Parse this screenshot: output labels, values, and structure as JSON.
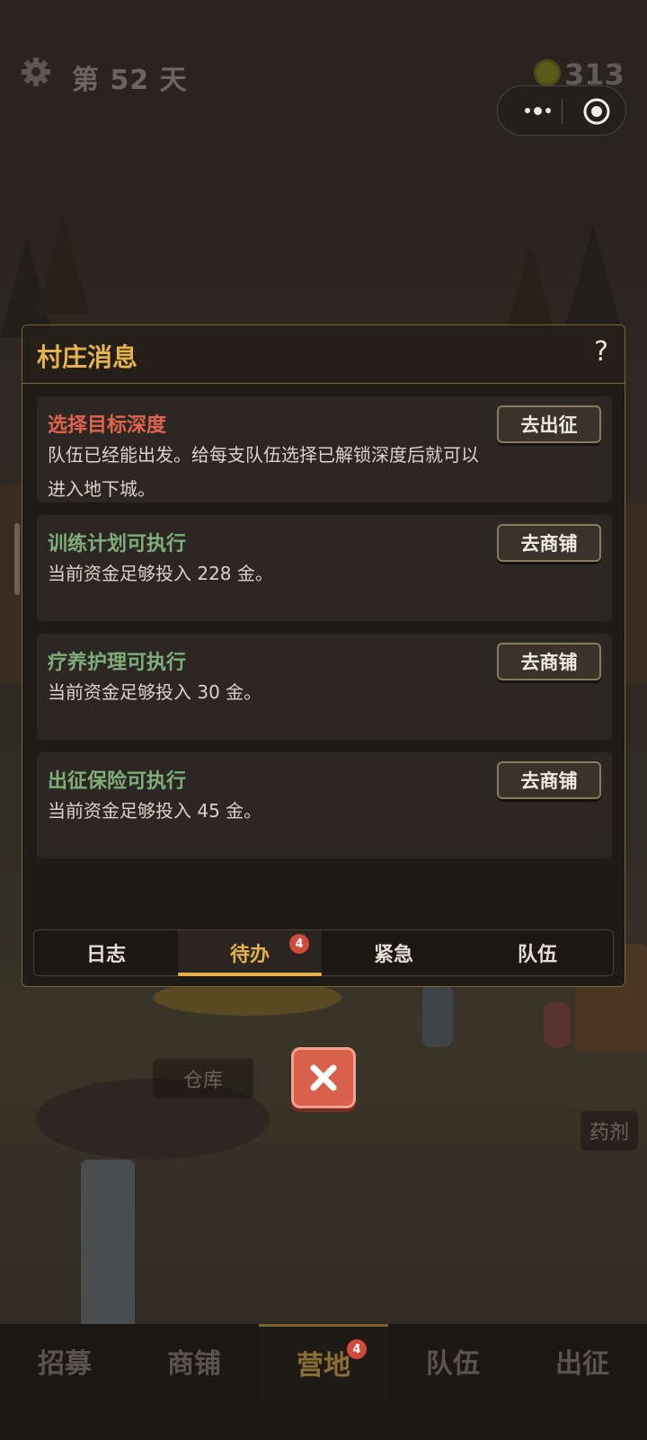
{
  "hud": {
    "day_label": "第 52 天",
    "gold": "313",
    "coin_color": "#5c5a1a"
  },
  "scene": {
    "warehouse_label": "仓库",
    "pharmacy_label": "药剂"
  },
  "dialog": {
    "title": "村庄消息",
    "help": "?",
    "cards": [
      {
        "title": "选择目标深度",
        "body": "队伍已经能出发。给每支队伍选择已解锁深度后就可以进入地下城。",
        "button": "去出征",
        "title_color": "#e2634d"
      },
      {
        "title": "训练计划可执行",
        "body": "当前资金足够投入 228 金。",
        "button": "去商铺",
        "title_color": "#7fae7a"
      },
      {
        "title": "疗养护理可执行",
        "body": "当前资金足够投入 30 金。",
        "button": "去商铺",
        "title_color": "#7fae7a"
      },
      {
        "title": "出征保险可执行",
        "body": "当前资金足够投入 45 金。",
        "button": "去商铺",
        "title_color": "#7fae7a"
      }
    ],
    "tabs": [
      {
        "label": "日志"
      },
      {
        "label": "待办",
        "badge": "4",
        "active": true
      },
      {
        "label": "紧急"
      },
      {
        "label": "队伍"
      }
    ]
  },
  "nav": {
    "items": [
      {
        "label": "招募"
      },
      {
        "label": "商铺"
      },
      {
        "label": "营地",
        "badge": "4",
        "active": true
      },
      {
        "label": "队伍"
      },
      {
        "label": "出征"
      }
    ]
  },
  "colors": {
    "accent": "#e6b34a",
    "close": "#d9604a"
  }
}
